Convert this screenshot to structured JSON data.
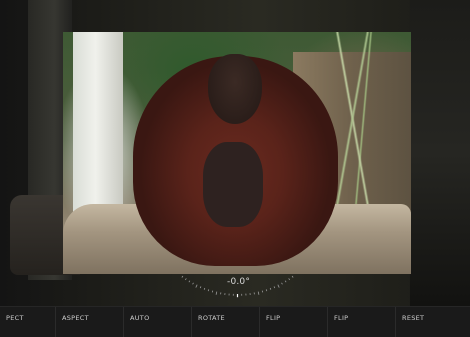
{
  "editor": {
    "rotation_readout": "-0.0°"
  },
  "toolbar": {
    "items": [
      {
        "label": "PECT"
      },
      {
        "label": "ASPECT"
      },
      {
        "label": "AUTO"
      },
      {
        "label": "ROTATE"
      },
      {
        "label": "FLIP"
      },
      {
        "label": "FLIP"
      },
      {
        "label": "RESET"
      }
    ]
  },
  "colors": {
    "toolbar_bg": "#1a1a1a",
    "toolbar_text": "#cfcfcf",
    "orangutan_fur": "#5a231a"
  }
}
